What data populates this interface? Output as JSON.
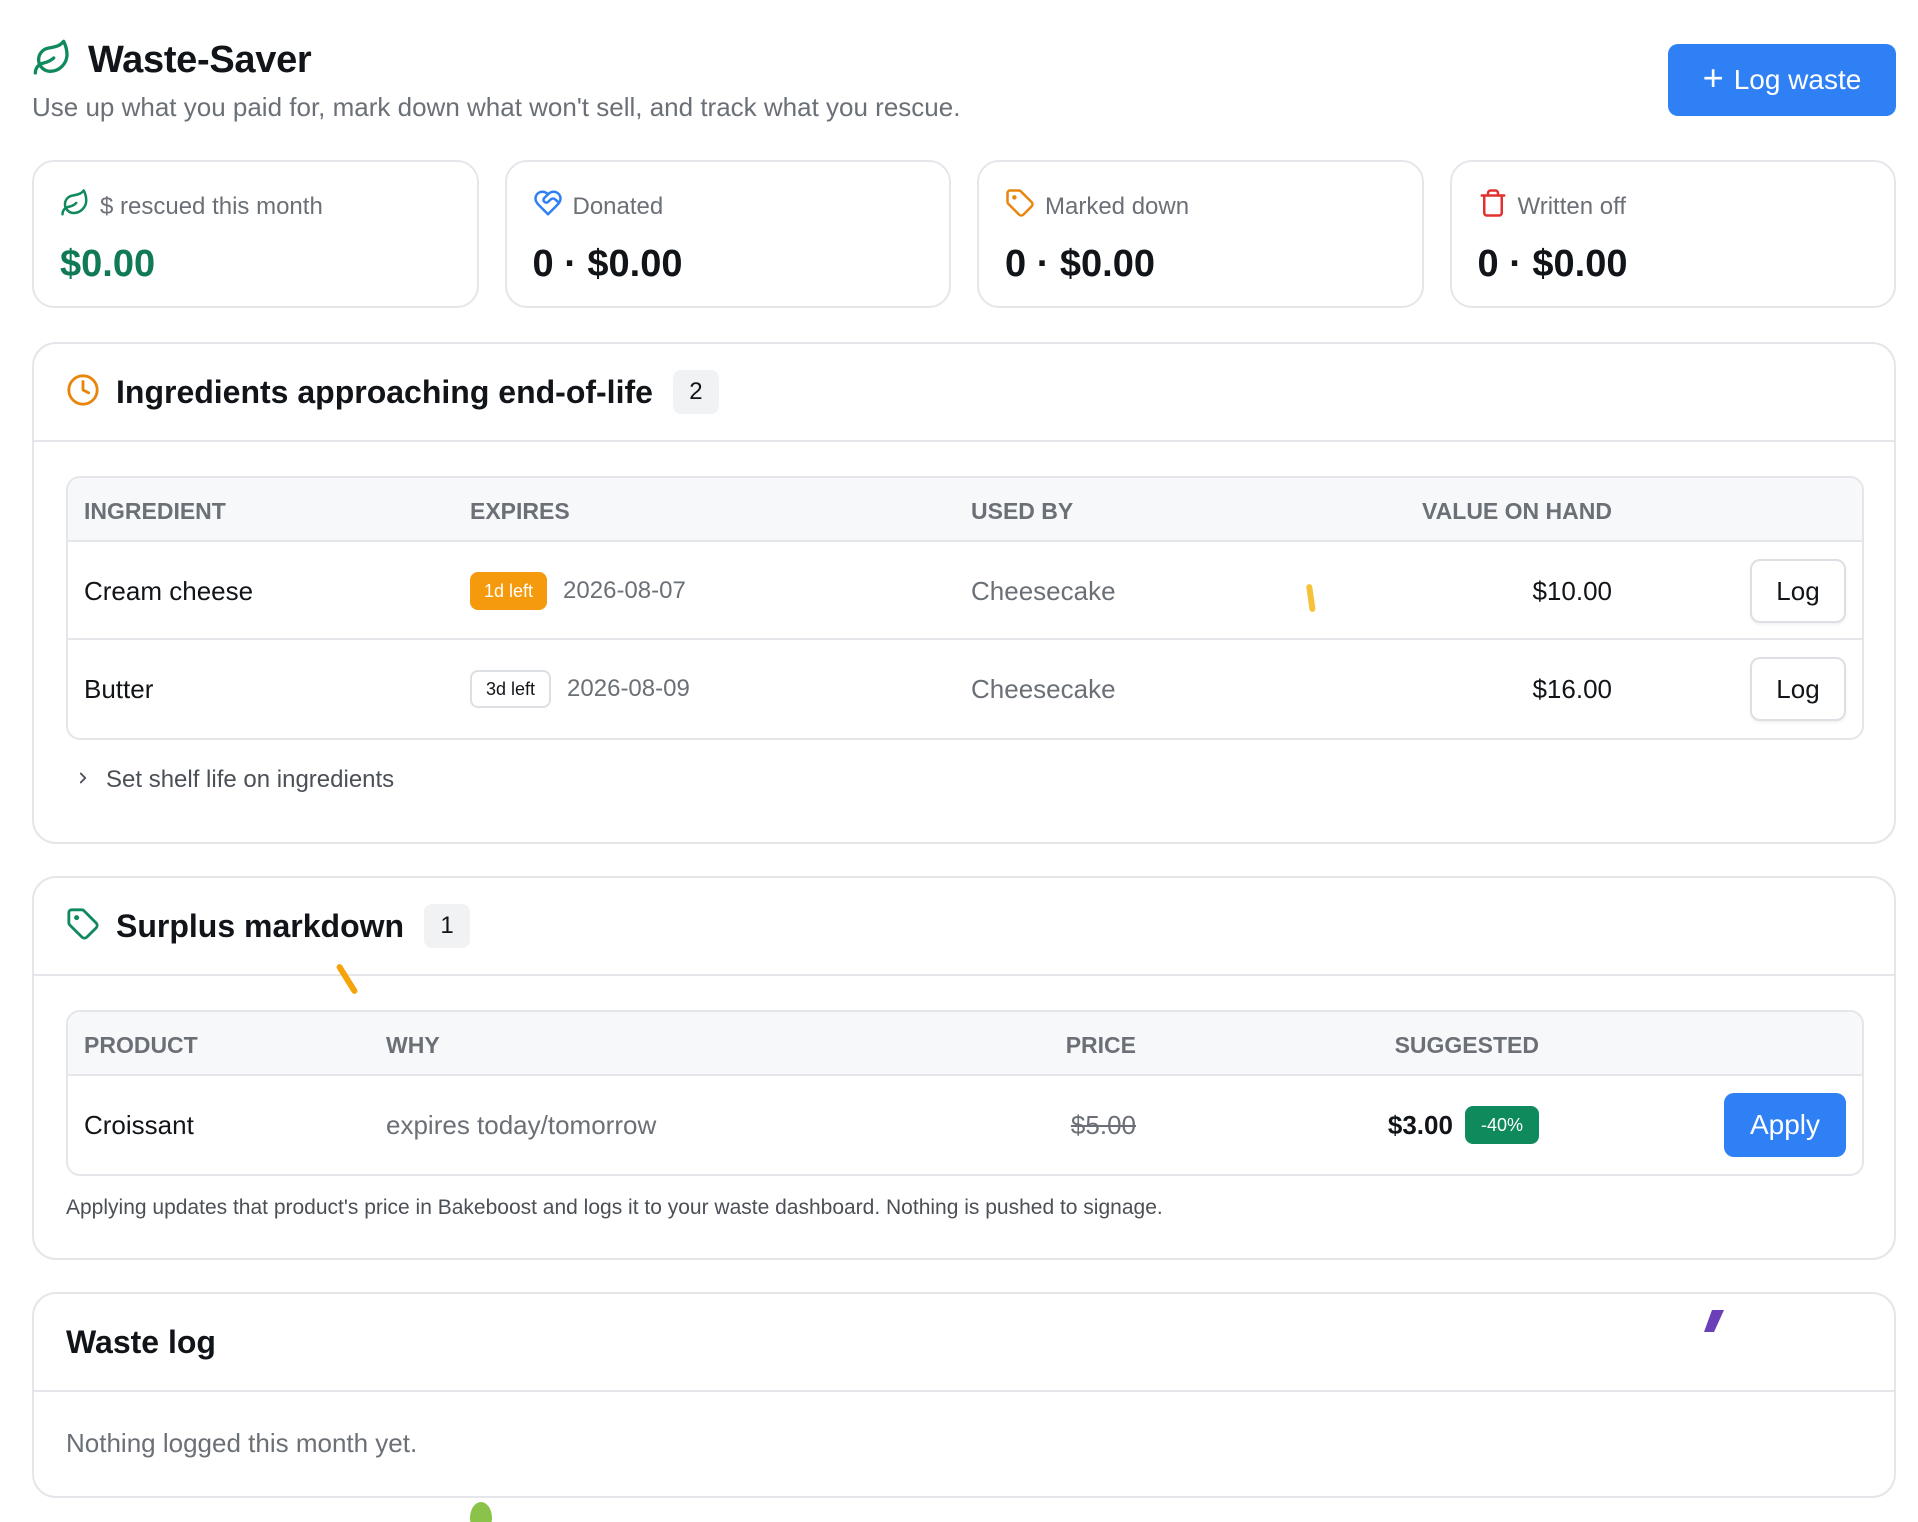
{
  "header": {
    "title": "Waste-Saver",
    "subtitle": "Use up what you paid for, mark down what won't sell, and track what you rescue.",
    "log_button": "Log waste",
    "accent": "#2f80f5"
  },
  "stats": [
    {
      "icon": "leaf-icon",
      "label": "$ rescued this month",
      "value": "$0.00"
    },
    {
      "icon": "heart-handshake-icon",
      "label": "Donated",
      "value": "0 · $0.00"
    },
    {
      "icon": "tag-icon",
      "label": "Marked down",
      "value": "0 · $0.00"
    },
    {
      "icon": "trash-icon",
      "label": "Written off",
      "value": "0 · $0.00"
    }
  ],
  "ingredients": {
    "title": "Ingredients approaching end-of-life",
    "count": "2",
    "columns": [
      "INGREDIENT",
      "EXPIRES",
      "USED BY",
      "VALUE ON HAND"
    ],
    "rows": [
      {
        "name": "Cream cheese",
        "badge": "1d left",
        "date": "2026-08-07",
        "used_by": "Cheesecake",
        "value": "$10.00",
        "action": "Log"
      },
      {
        "name": "Butter",
        "badge": "3d left",
        "date": "2026-08-09",
        "used_by": "Cheesecake",
        "value": "$16.00",
        "action": "Log"
      }
    ],
    "toggle": "Set shelf life on ingredients"
  },
  "markdown": {
    "title": "Surplus markdown",
    "count": "1",
    "columns": [
      "PRODUCT",
      "WHY",
      "PRICE",
      "SUGGESTED"
    ],
    "rows": [
      {
        "product": "Croissant",
        "why": "expires today/tomorrow",
        "price": "$5.00",
        "suggested": "$3.00",
        "discount": "-40%",
        "action": "Apply"
      }
    ],
    "note": "Applying updates that product's price in Bakeboost and logs it to your waste dashboard. Nothing is pushed to signage."
  },
  "waste_log": {
    "title": "Waste log",
    "empty": "Nothing logged this month yet."
  }
}
